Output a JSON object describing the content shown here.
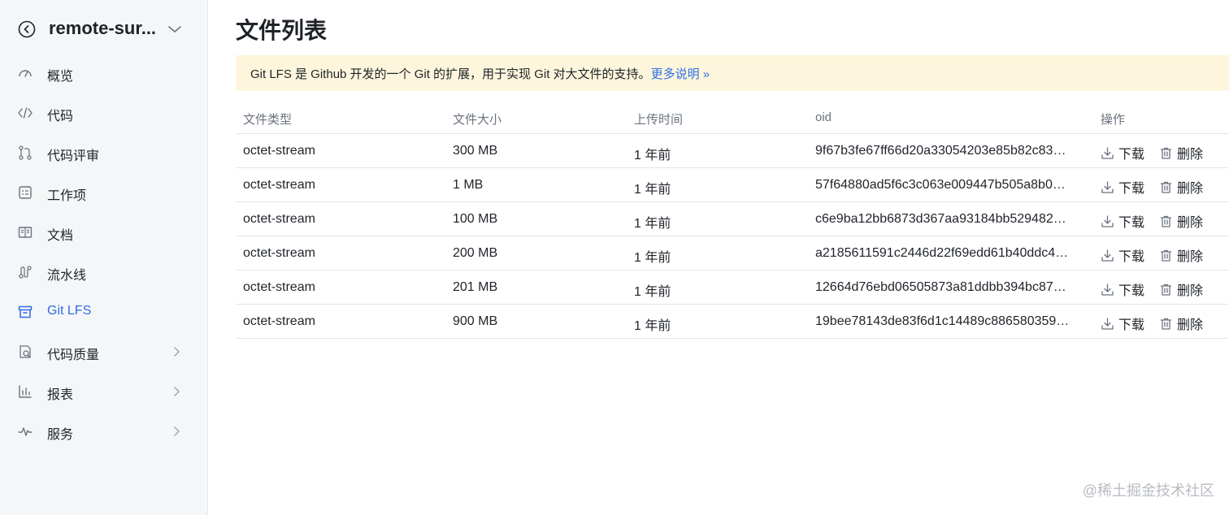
{
  "sidebar": {
    "project_name": "remote-sur...",
    "items": [
      {
        "label": "概览",
        "icon": "dashboard-icon",
        "has_arrow": false
      },
      {
        "label": "代码",
        "icon": "code-icon",
        "has_arrow": false
      },
      {
        "label": "代码评审",
        "icon": "merge-request-icon",
        "has_arrow": false
      },
      {
        "label": "工作项",
        "icon": "task-icon",
        "has_arrow": false
      },
      {
        "label": "文档",
        "icon": "doc-icon",
        "has_arrow": false
      },
      {
        "label": "流水线",
        "icon": "pipeline-icon",
        "has_arrow": false
      },
      {
        "label": "Git LFS",
        "icon": "archive-icon",
        "has_arrow": false,
        "active": true
      },
      {
        "label": "代码质量",
        "icon": "quality-icon",
        "has_arrow": true
      },
      {
        "label": "报表",
        "icon": "bar-chart-icon",
        "has_arrow": true
      },
      {
        "label": "服务",
        "icon": "pulse-icon",
        "has_arrow": true
      }
    ]
  },
  "main": {
    "title": "文件列表",
    "notice": {
      "text": "Git LFS 是 Github 开发的一个 Git 的扩展，用于实现 Git 对大文件的支持。",
      "link": "更多说明 »"
    },
    "table": {
      "headers": {
        "type": "文件类型",
        "size": "文件大小",
        "time": "上传时间",
        "oid": "oid",
        "op": "操作"
      },
      "rows": [
        {
          "type": "octet-stream",
          "size": "300 MB",
          "time": "1 年前",
          "oid": "9f67b3fe67ff66d20a33054203e85b82c834…"
        },
        {
          "type": "octet-stream",
          "size": "1 MB",
          "time": "1 年前",
          "oid": "57f64880ad5f6c3c063e009447b505a8b0a…"
        },
        {
          "type": "octet-stream",
          "size": "100 MB",
          "time": "1 年前",
          "oid": "c6e9ba12bb6873d367aa93184bb529482da…"
        },
        {
          "type": "octet-stream",
          "size": "200 MB",
          "time": "1 年前",
          "oid": "a2185611591c2446d22f69edd61b40ddc45…"
        },
        {
          "type": "octet-stream",
          "size": "201 MB",
          "time": "1 年前",
          "oid": "12664d76ebd06505873a81ddbb394bc87c9…"
        },
        {
          "type": "octet-stream",
          "size": "900 MB",
          "time": "1 年前",
          "oid": "19bee78143de83f6d1c14489c886580359e…"
        }
      ],
      "download_label": "下载",
      "delete_label": "删除"
    }
  },
  "watermark": "@稀土掘金技术社区",
  "colors": {
    "accent": "#2f6ce5",
    "notice_bg": "#fdf6dc",
    "sidebar_bg": "#f5f6f7"
  }
}
